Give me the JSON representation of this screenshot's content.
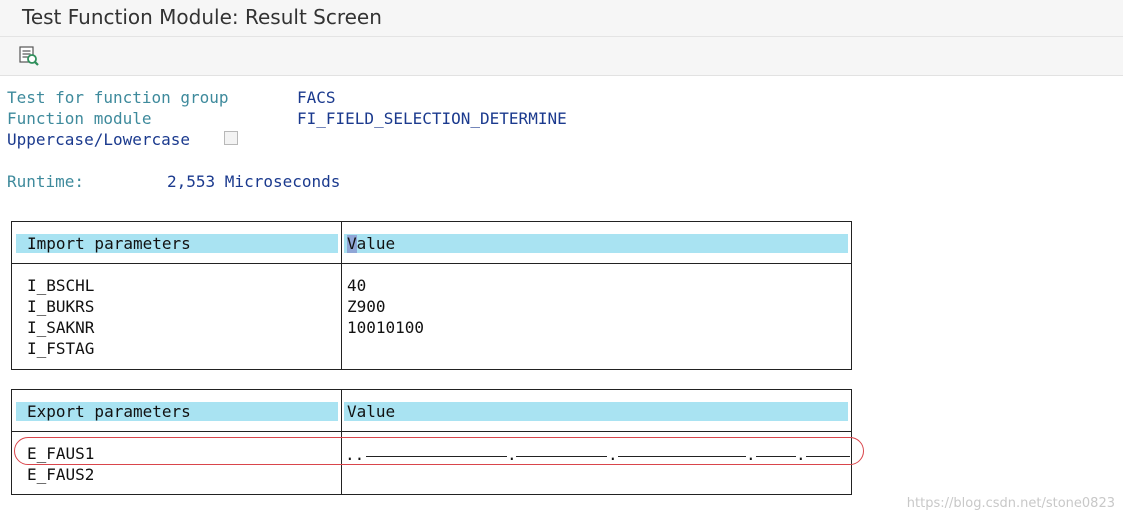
{
  "window": {
    "title": "Test Function Module: Result Screen"
  },
  "toolbar": {
    "buttons": [
      {
        "icon": "text-detail-icon"
      }
    ]
  },
  "header": {
    "function_group_label": "Test for function group",
    "function_group_value": "FACS",
    "function_module_label": "Function module",
    "function_module_value": "FI_FIELD_SELECTION_DETERMINE",
    "case_label": "Uppercase/Lowercase",
    "case_checked": false,
    "runtime_label": "Runtime:",
    "runtime_value": "2,553 Microseconds"
  },
  "import_table": {
    "header_name": "Import parameters",
    "header_value": "Value",
    "rows": [
      {
        "name": "I_BSCHL",
        "value": "40"
      },
      {
        "name": "I_BUKRS",
        "value": "Z900"
      },
      {
        "name": "I_SAKNR",
        "value": "10010100"
      },
      {
        "name": "I_FSTAG",
        "value": ""
      }
    ]
  },
  "export_table": {
    "header_name": "Export parameters",
    "header_value": "Value",
    "rows": [
      {
        "name": "E_FAUS1",
        "value": "..",
        "separators": [
          ".",
          ".",
          "."
        ],
        "highlighted": true
      },
      {
        "name": "E_FAUS2",
        "value": ""
      }
    ]
  },
  "watermark": "https://blog.csdn.net/stone0823",
  "colors": {
    "header_bar": "#a9e3f2",
    "label_teal": "#3e8a9c",
    "value_navy": "#1b3a8e",
    "highlight_oval": "#d9454b"
  }
}
